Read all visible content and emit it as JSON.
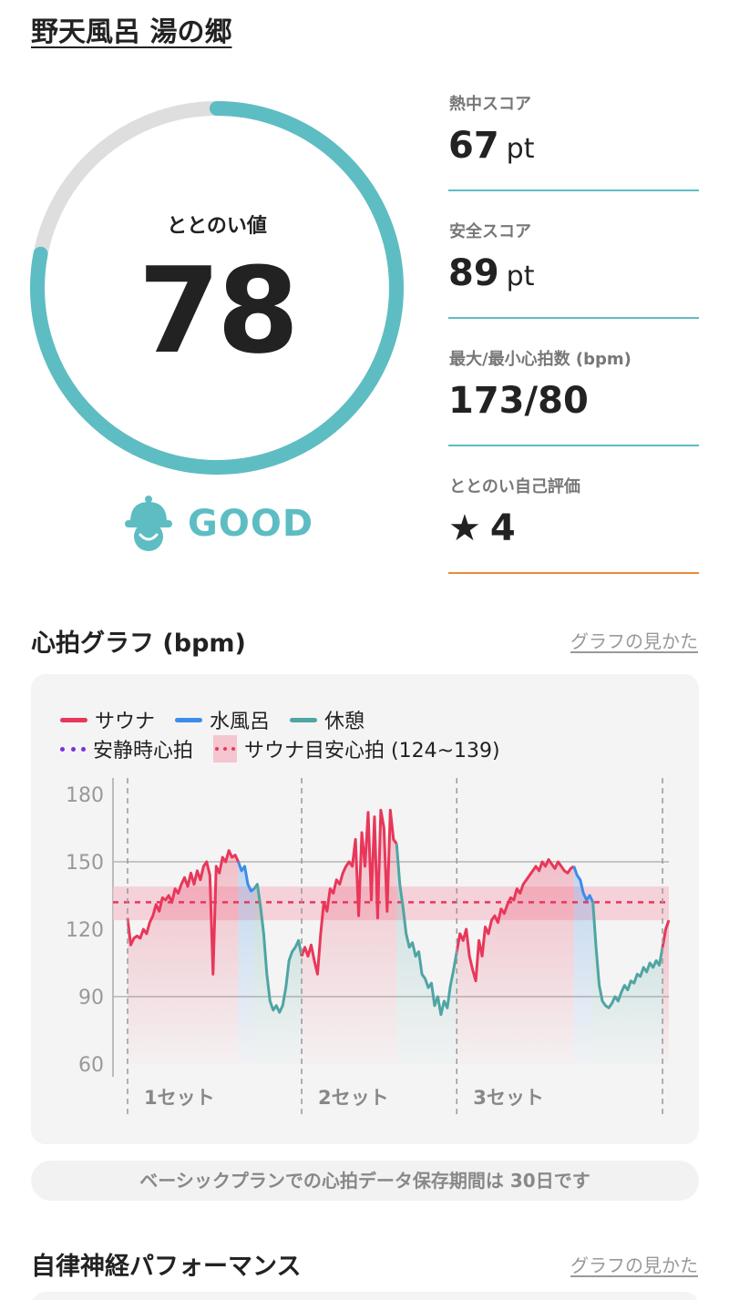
{
  "facility": {
    "name": "野天風呂 湯の郷"
  },
  "totonoi": {
    "label": "ととのい値",
    "value": 78,
    "max": 100,
    "rating": "GOOD",
    "rating_icon": "sauna-hat-face-icon"
  },
  "metrics": [
    {
      "label": "熱中スコア",
      "value": "67",
      "unit": "pt"
    },
    {
      "label": "安全スコア",
      "value": "89",
      "unit": "pt"
    },
    {
      "label": "最大/最小心拍数 (bpm)",
      "value": "173/80",
      "unit": ""
    },
    {
      "label": "ととのい自己評価",
      "star": "★",
      "value": "4",
      "unit": ""
    }
  ],
  "heart_section": {
    "title": "心拍グラフ (bpm)",
    "link": "グラフの見かた"
  },
  "legend": {
    "sauna": "サウナ",
    "cold_bath": "水風呂",
    "rest": "休憩",
    "resting_hr": "安静時心拍",
    "sauna_target": "サウナ目安心拍 (124~139)"
  },
  "colors": {
    "accent": "#5dbdc3",
    "sauna": "#e8375a",
    "cold_bath": "#3b8de8",
    "rest": "#4fa5a3",
    "resting": "#7a2fe0",
    "rating_line": "#e98b3a"
  },
  "chart_data": {
    "type": "line",
    "ylim": [
      60,
      180
    ],
    "yticks": [
      60,
      90,
      120,
      150,
      180
    ],
    "target_band": [
      124,
      139
    ],
    "target_line": 132,
    "set_labels": [
      "1セット",
      "2セット",
      "3セット"
    ],
    "phases": [
      {
        "type": "sauna",
        "values": [
          125,
          113,
          116,
          117,
          116,
          120,
          118,
          123,
          126,
          131,
          128,
          134,
          133,
          135,
          132,
          138,
          136,
          140,
          143,
          139,
          145,
          140,
          146,
          142,
          148,
          150,
          144,
          100,
          148,
          145,
          152,
          150,
          155,
          152,
          153
        ]
      },
      {
        "type": "cold",
        "values": [
          150,
          146,
          148,
          140,
          137
        ]
      },
      {
        "type": "rest",
        "values": [
          138,
          140,
          130,
          118,
          100,
          88,
          84,
          86,
          83,
          86,
          94,
          106,
          110,
          112,
          115
        ]
      },
      {
        "type": "sauna",
        "values": [
          108,
          112,
          108,
          113,
          106,
          100,
          118,
          132,
          128,
          138,
          136,
          142,
          140,
          145,
          148,
          150,
          148,
          160,
          126,
          163,
          148,
          172,
          133,
          170,
          125,
          173,
          165,
          128,
          173,
          160
        ]
      },
      {
        "type": "rest",
        "values": [
          158,
          140,
          130,
          118,
          112,
          114,
          108,
          110,
          100,
          98,
          94,
          96,
          86,
          90,
          82,
          88,
          85,
          95,
          102
        ]
      },
      {
        "type": "sauna",
        "values": [
          110,
          118,
          115,
          120,
          108,
          102,
          97,
          115,
          108,
          121,
          118,
          124,
          126,
          123,
          129,
          127,
          131,
          134,
          133,
          138,
          136,
          140,
          142,
          144,
          146,
          148,
          146,
          150,
          148,
          151,
          149,
          147,
          150,
          148,
          146,
          145,
          147
        ]
      },
      {
        "type": "cold",
        "values": [
          148,
          144,
          142,
          136,
          133,
          135
        ]
      },
      {
        "type": "rest",
        "values": [
          132,
          112,
          95,
          88,
          86,
          85,
          87,
          90,
          88,
          92,
          95,
          93,
          97,
          96,
          100,
          99,
          103,
          101,
          105,
          103,
          106,
          104
        ]
      },
      {
        "type": "sauna",
        "values": [
          112,
          120,
          124
        ]
      }
    ]
  },
  "notice": "ベーシックプランでの心拍データ保存期間は 30日です",
  "autonomic_section": {
    "title": "自律神経パフォーマンス",
    "link": "グラフの見かた"
  }
}
